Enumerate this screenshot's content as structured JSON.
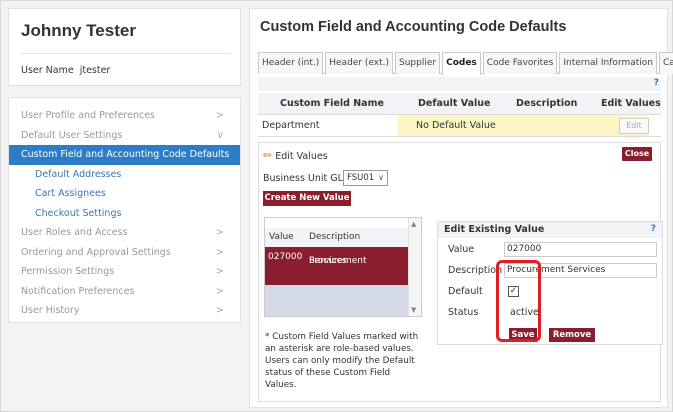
{
  "user": {
    "name": "Johnny Tester",
    "username_label": "User Name",
    "username": "jtester"
  },
  "nav": [
    {
      "label": "User Profile and Preferences",
      "chevron": ">"
    },
    {
      "label": "Default User Settings",
      "chevron": "v"
    },
    {
      "label": "Custom Field and Accounting Code Defaults",
      "active": true
    },
    {
      "label": "Default Addresses"
    },
    {
      "label": "Cart Assignees"
    },
    {
      "label": "Checkout Settings"
    },
    {
      "label": "User Roles and Access",
      "chevron": ">"
    },
    {
      "label": "Ordering and Approval Settings",
      "chevron": ">"
    },
    {
      "label": "Permission Settings",
      "chevron": ">"
    },
    {
      "label": "Notification Preferences",
      "chevron": ">"
    },
    {
      "label": "User History",
      "chevron": ">"
    }
  ],
  "panel": {
    "title": "Custom Field and Accounting Code Defaults",
    "tabs": [
      "Header (int.)",
      "Header (ext.)",
      "Supplier",
      "Codes",
      "Code Favorites",
      "Internal Information",
      "Cart"
    ],
    "active_tab": "Codes",
    "help": "?"
  },
  "table": {
    "headers": [
      "Custom Field Name",
      "Default Value",
      "Description",
      "Edit Values"
    ],
    "row": {
      "name": "Department",
      "default": "No Default Value",
      "edit": "Edit"
    }
  },
  "editor": {
    "title": "Edit Values",
    "close": "Close",
    "bu_label": "Business Unit GL",
    "bu_value": "FSU01",
    "create": "Create New Value",
    "list_headers": [
      "Value",
      "Description"
    ],
    "list_row": {
      "value": "027000",
      "desc_line1": "Procurement",
      "desc_line2": "Services"
    },
    "note": "* Custom Field Values marked with an asterisk are role-based values. Users can only modify the Default status of these Custom Field Values."
  },
  "eev": {
    "title": "Edit Existing Value",
    "help": "?",
    "value_label": "Value",
    "value": "027000",
    "desc_label": "Description",
    "desc": "Procurement Services",
    "default_label": "Default",
    "default_checked": true,
    "status_label": "Status",
    "status": "active",
    "save": "Save",
    "remove": "Remove"
  },
  "colors": {
    "accent_blue": "#2c7cc7",
    "button_maroon": "#8b1e2e",
    "highlight_red": "#e02020",
    "default_value_yellow": "#fbf6c4"
  }
}
